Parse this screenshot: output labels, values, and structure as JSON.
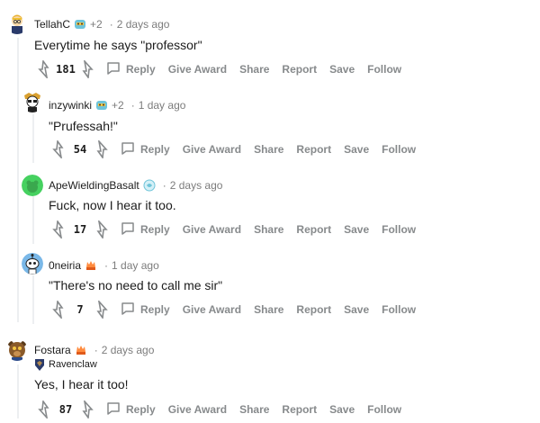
{
  "actions": {
    "reply": "Reply",
    "give_award": "Give Award",
    "share": "Share",
    "report": "Report",
    "save": "Save",
    "follow": "Follow"
  },
  "comments": [
    {
      "author": "TellahC",
      "award_count": "+2",
      "dot": "·",
      "time": "2 days ago",
      "body": "Everytime he says \"professor\"",
      "score": "181"
    },
    {
      "author": "inzywinki",
      "award_count": "+2",
      "dot": "·",
      "time": "1 day ago",
      "body": "\"Prufessah!\"",
      "score": "54"
    },
    {
      "author": "ApeWieldingBasalt",
      "dot": "·",
      "time": "2 days ago",
      "body": "Fuck, now I hear it too.",
      "score": "17"
    },
    {
      "author": "0neiria",
      "dot": "·",
      "time": "1 day ago",
      "body": "\"There's no need to call me sir\"",
      "score": "7"
    },
    {
      "author": "Fostara",
      "dot": "·",
      "time": "2 days ago",
      "flair": "Ravenclaw",
      "body": "Yes, I hear it too!",
      "score": "87"
    }
  ],
  "colors": {
    "text": "#1c1c1c",
    "meta": "#7c7c7c",
    "action": "#878a8c",
    "thread": "#edeff1"
  }
}
